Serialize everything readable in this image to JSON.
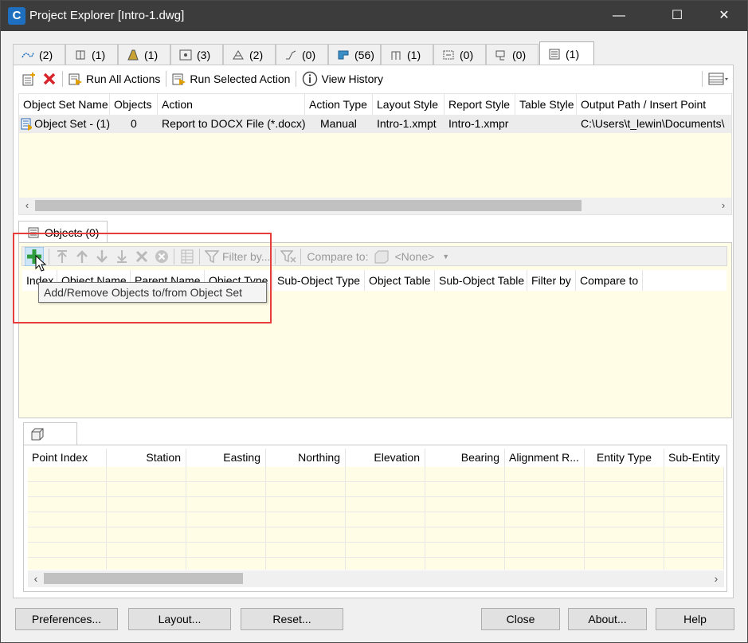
{
  "window": {
    "title": "Project Explorer [Intro-1.dwg]",
    "app_icon": "C"
  },
  "tabs": [
    {
      "icon": "alignment-icon",
      "count": "(2)"
    },
    {
      "icon": "structure-icon",
      "count": "(1)"
    },
    {
      "icon": "corridor-icon",
      "count": "(1)"
    },
    {
      "icon": "points-icon",
      "count": "(3)"
    },
    {
      "icon": "surface-icon",
      "count": "(2)"
    },
    {
      "icon": "polyline-icon",
      "count": "(0)"
    },
    {
      "icon": "parcel-icon",
      "count": "(56)"
    },
    {
      "icon": "pipe-network-icon",
      "count": "(1)"
    },
    {
      "icon": "section-icon",
      "count": "(0)"
    },
    {
      "icon": "figure-icon",
      "count": "(0)"
    },
    {
      "icon": "object-set-icon",
      "count": "(1)"
    }
  ],
  "toolbar": {
    "run_all": "Run All Actions",
    "run_selected": "Run Selected Action",
    "view_history": "View History"
  },
  "object_sets": {
    "columns": [
      "Object Set Name",
      "Objects",
      "Action",
      "Action Type",
      "Layout Style",
      "Report Style",
      "Table Style",
      "Output Path / Insert Point"
    ],
    "rows": [
      [
        "Object Set - (1)",
        "0",
        "Report to DOCX File (*.docx)",
        "Manual",
        "Intro-1.xmpt",
        "Intro-1.xmpr",
        "",
        "C:\\Users\\t_lewin\\Documents\\"
      ]
    ]
  },
  "objects_tab": {
    "label": "Objects (0)"
  },
  "objects_toolbar": {
    "filter_label": "Filter by...",
    "compare_label": "Compare to:",
    "compare_value": "<None>"
  },
  "objects_grid": {
    "columns": [
      "Index",
      "Object Name",
      "Parent Name",
      "Object Type",
      "Sub-Object Type",
      "Object Table",
      "Sub-Object Table",
      "Filter by",
      "Compare to"
    ]
  },
  "tooltip": "Add/Remove Objects to/from Object Set",
  "points_grid": {
    "columns": [
      "Point Index",
      "Station",
      "Easting",
      "Northing",
      "Elevation",
      "Bearing",
      "Alignment R...",
      "Entity Type",
      "Sub-Entity"
    ]
  },
  "buttons": {
    "preferences": "Preferences...",
    "layout": "Layout...",
    "reset": "Reset...",
    "close": "Close",
    "about": "About...",
    "help": "Help"
  },
  "colors": {
    "grid_background": "#fffde6",
    "highlight": "#e63c3c",
    "titlebar": "#3c3c3c",
    "add_icon": "#2e9e3e"
  }
}
